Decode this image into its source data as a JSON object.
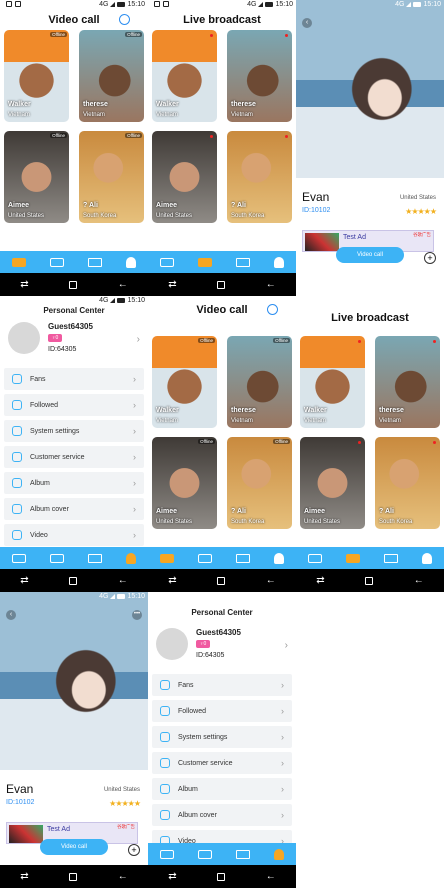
{
  "status": {
    "time": "15:10",
    "network": "4G"
  },
  "grid_pages": [
    {
      "title": "Video call",
      "has_search": true,
      "show_tag": true,
      "cards": [
        {
          "name": "Walker",
          "location": "Vietnam",
          "tag": "Offline"
        },
        {
          "name": "therese",
          "location": "Vietnam",
          "tag": "Offline"
        },
        {
          "name": "Aimee",
          "location": "United States",
          "tag": "Offline"
        },
        {
          "name": "? Ali",
          "location": "South Korea",
          "tag": "Offline"
        }
      ]
    },
    {
      "title": "Live broadcast",
      "has_search": false,
      "show_tag": false,
      "cards": [
        {
          "name": "Walker",
          "location": "Vietnam"
        },
        {
          "name": "therese",
          "location": "Vietnam"
        },
        {
          "name": "Aimee",
          "location": "United States"
        },
        {
          "name": "? Ali",
          "location": "South Korea"
        }
      ]
    }
  ],
  "profile": {
    "name": "Evan",
    "id": "ID:10102",
    "location": "United States",
    "stars": "★★★★★",
    "ad_text": "Flood-It!",
    "ad_title": "Test Ad",
    "ad_label": "谷歌广告",
    "video_call": "Video call",
    "more": "•••",
    "back": "‹"
  },
  "personal_center": {
    "title": "Personal Center",
    "username": "Guest64305",
    "level": "♀0",
    "id": "ID:64305",
    "menu": [
      {
        "label": "Fans",
        "icon": "fans-icon"
      },
      {
        "label": "Followed",
        "icon": "user-icon"
      },
      {
        "label": "System settings",
        "icon": "gear-icon"
      },
      {
        "label": "Customer service",
        "icon": "headset-icon"
      },
      {
        "label": "Album",
        "icon": "album-icon"
      },
      {
        "label": "Album cover",
        "icon": "image-icon"
      },
      {
        "label": "Video",
        "icon": "video-icon"
      }
    ]
  },
  "bottom_nav": [
    "video-tab-icon",
    "live-tab-icon",
    "message-tab-icon",
    "profile-tab-icon"
  ],
  "android_nav": {
    "back": "←",
    "home": "□",
    "recent": "⇄"
  }
}
